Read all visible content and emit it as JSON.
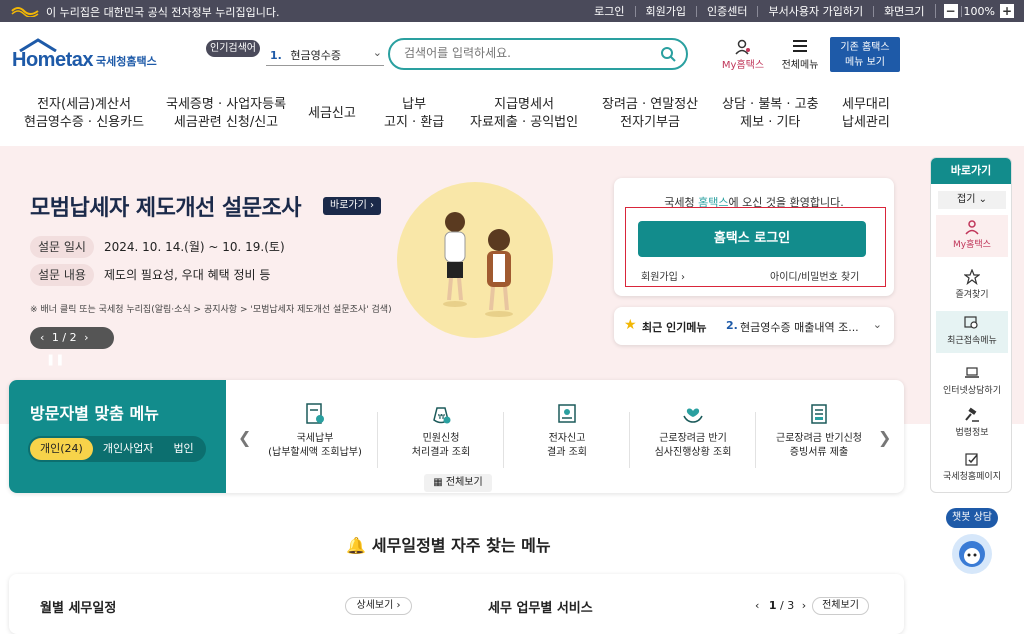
{
  "govbar": {
    "text": "이 누리집은 대한민국 공식 전자정부 누리집입니다.",
    "links": [
      "로그인",
      "회원가입",
      "인증센터",
      "부서사용자 가입하기",
      "화면크기"
    ],
    "zoom": "100%",
    "zoom_minus": "−",
    "zoom_plus": "+"
  },
  "header": {
    "logo_main": "Hometax",
    "logo_sub": "국세청홈택스",
    "popular_tag": "인기검색어",
    "popular_num": "1.",
    "popular_value": "현금영수증",
    "search_placeholder": "검색어를 입력하세요.",
    "my_hometax": "My홈택스",
    "all_menu": "전체메뉴",
    "legacy_line1": "기존 홈택스",
    "legacy_line2": "메뉴 보기"
  },
  "gnb": [
    {
      "l1": "전자(세금)계산서",
      "l2": "현금영수증 · 신용카드"
    },
    {
      "l1": "국세증명 · 사업자등록",
      "l2": "세금관련 신청/신고"
    },
    {
      "l1": "세금신고",
      "l2": ""
    },
    {
      "l1": "납부",
      "l2": "고지 · 환급"
    },
    {
      "l1": "지급명세서",
      "l2": "자료제출 · 공익법인"
    },
    {
      "l1": "장려금 · 연말정산",
      "l2": "전자기부금"
    },
    {
      "l1": "상담 · 불복 · 고충",
      "l2": "제보 · 기타"
    },
    {
      "l1": "세무대리",
      "l2": "납세관리"
    }
  ],
  "hero": {
    "title": "모범납세자 제도개선 설문조사",
    "go": "바로가기",
    "date_tag": "설문 일시",
    "date_val": "2024. 10. 14.(월) ~ 10. 19.(토)",
    "content_tag": "설문 내용",
    "content_val": "제도의 필요성, 우대 혜택 정비 등",
    "note": "※ 배너 클릭 또는 국세청 누리집(알림·소식 > 공지사항 > '모범납세자 제도개선 설문조사' 검색)",
    "pager": "1 / 2"
  },
  "login": {
    "welcome_pre": "국세청 ",
    "welcome_hl": "홈택스",
    "welcome_post": "에 오신 것을 환영합니다.",
    "button": "홈택스 로그인",
    "signup": "회원가입",
    "find": "아이디/비밀번호 찾기"
  },
  "popular_menu": {
    "label": "최근 인기메뉴",
    "num": "2.",
    "value": "현금영수증 매출내역 조..."
  },
  "side": {
    "head": "바로가기",
    "fold": "접기",
    "items": [
      "My홈택스",
      "즐겨찾기",
      "최근접속메뉴",
      "인터넷상담하기",
      "법령정보",
      "국세청홈페이지"
    ],
    "chatbot": "챗봇 상담"
  },
  "visitor": {
    "title": "방문자별 맞춤 메뉴",
    "tabs": [
      "개인(24)",
      "개인사업자",
      "법인"
    ],
    "items": [
      {
        "l1": "국세납부",
        "l2": "(납부할세액 조회납부)"
      },
      {
        "l1": "민원신청",
        "l2": "처리결과 조회"
      },
      {
        "l1": "전자신고",
        "l2": "결과 조회"
      },
      {
        "l1": "근로장려금 반기",
        "l2": "심사진행상황 조회"
      },
      {
        "l1": "근로장려금 반기신청",
        "l2": "증빙서류 제출"
      }
    ],
    "all": "전체보기"
  },
  "schedule": {
    "heading": "세무일정별 자주 찾는 메뉴",
    "monthly": "월별 세무일정",
    "detail": "상세보기",
    "biz": "세무 업무별 서비스",
    "page_cur": "1",
    "page_total": "3",
    "all": "전체보기"
  }
}
